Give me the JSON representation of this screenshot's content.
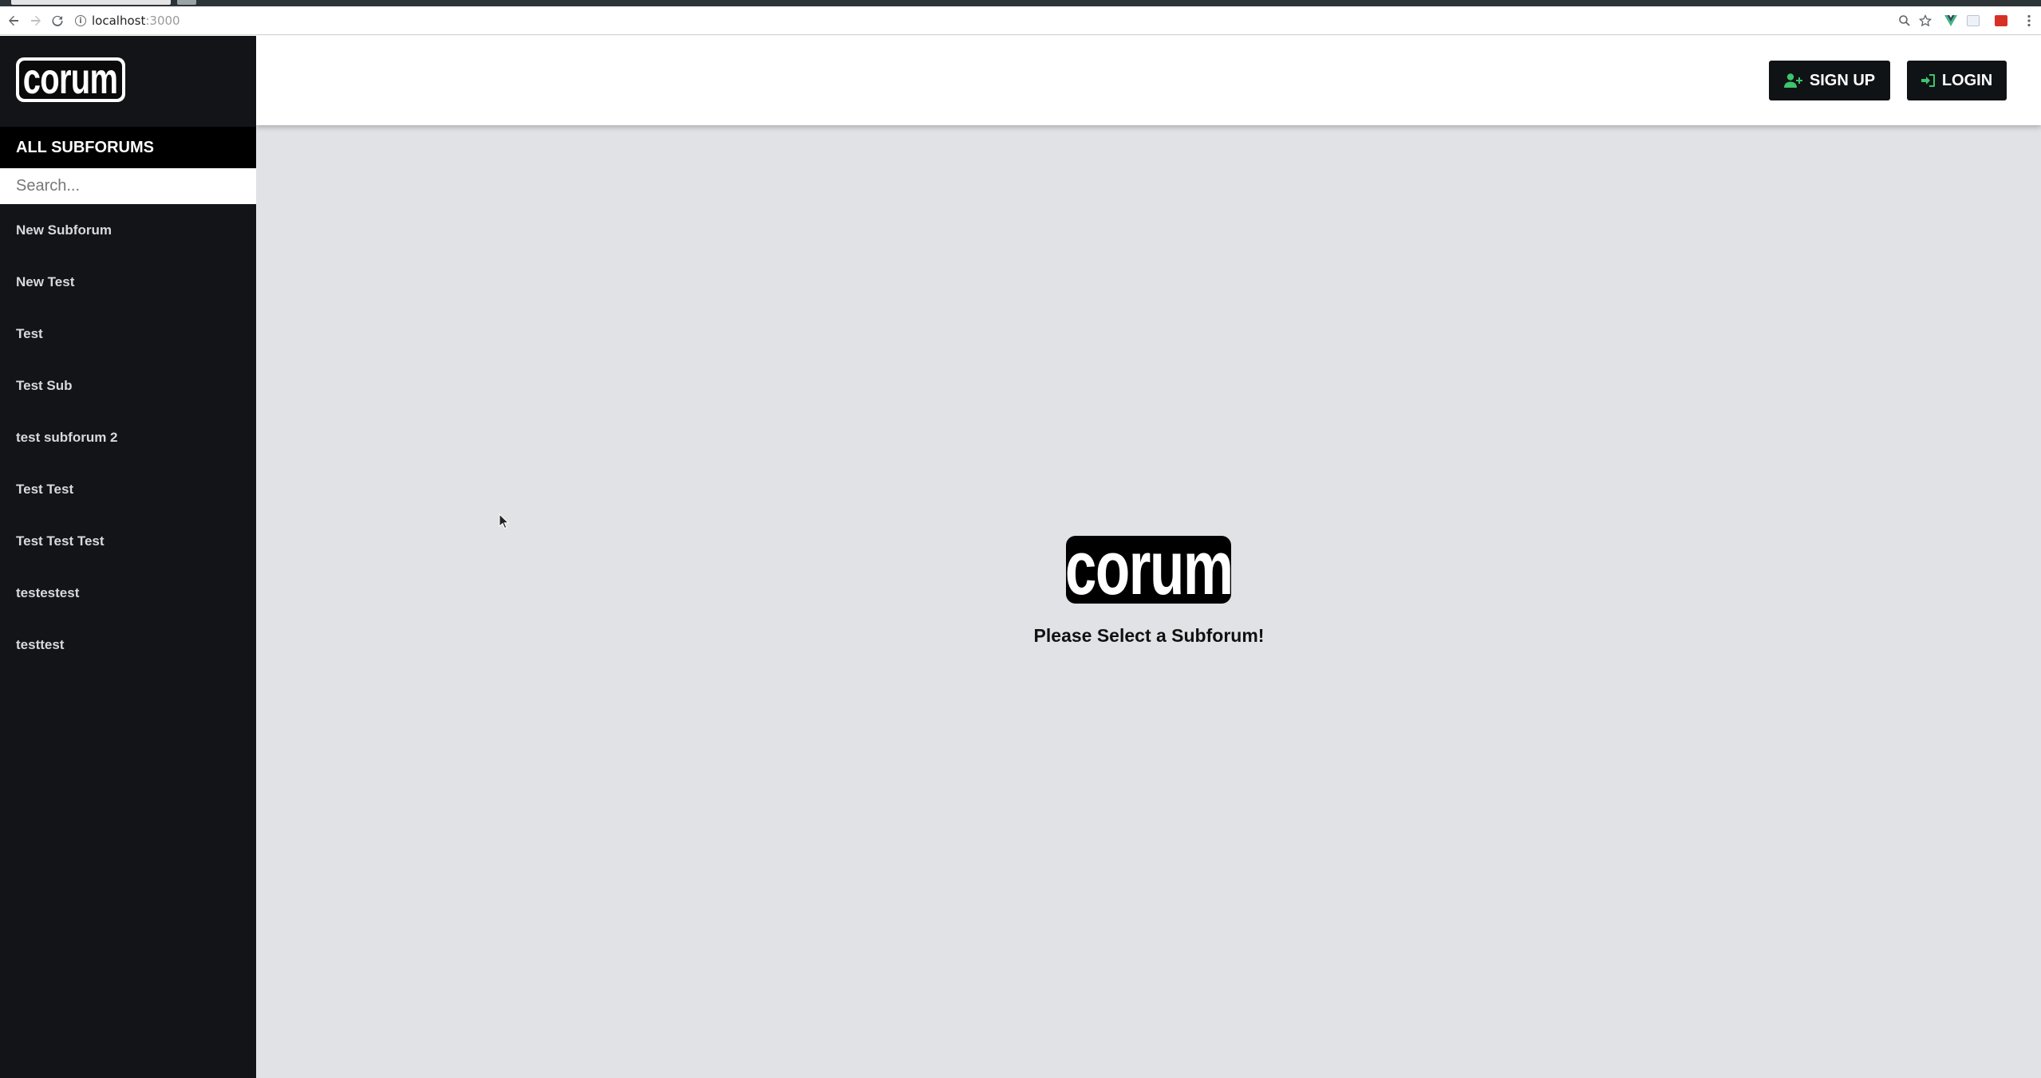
{
  "browser": {
    "url_host": "localhost",
    "url_port": ":3000",
    "icons": [
      "back-icon",
      "forward-icon",
      "reload-icon",
      "info-icon",
      "zoom-icon",
      "star-icon",
      "vue-devtools-icon",
      "extension-icon",
      "extension-red-icon",
      "more-icon"
    ]
  },
  "sidebar": {
    "logo_text": "corum",
    "heading": "ALL SUBFORUMS",
    "search_placeholder": "Search...",
    "items": [
      {
        "label": "New Subforum"
      },
      {
        "label": "New Test"
      },
      {
        "label": "Test"
      },
      {
        "label": "Test Sub"
      },
      {
        "label": "test subforum 2"
      },
      {
        "label": "Test Test"
      },
      {
        "label": "Test Test Test"
      },
      {
        "label": "testestest"
      },
      {
        "label": "testtest"
      }
    ]
  },
  "header": {
    "signup_label": "SIGN UP",
    "login_label": "LOGIN",
    "signup_icon": "user-plus-icon",
    "login_icon": "sign-in-icon"
  },
  "main": {
    "logo_text": "corum",
    "message": "Please Select a Subforum!"
  },
  "colors": {
    "sidebar_bg": "#121418",
    "heading_bg": "#000000",
    "main_bg": "#e1e2e5",
    "button_bg": "#101316",
    "button_icon": "#3ec46d"
  }
}
